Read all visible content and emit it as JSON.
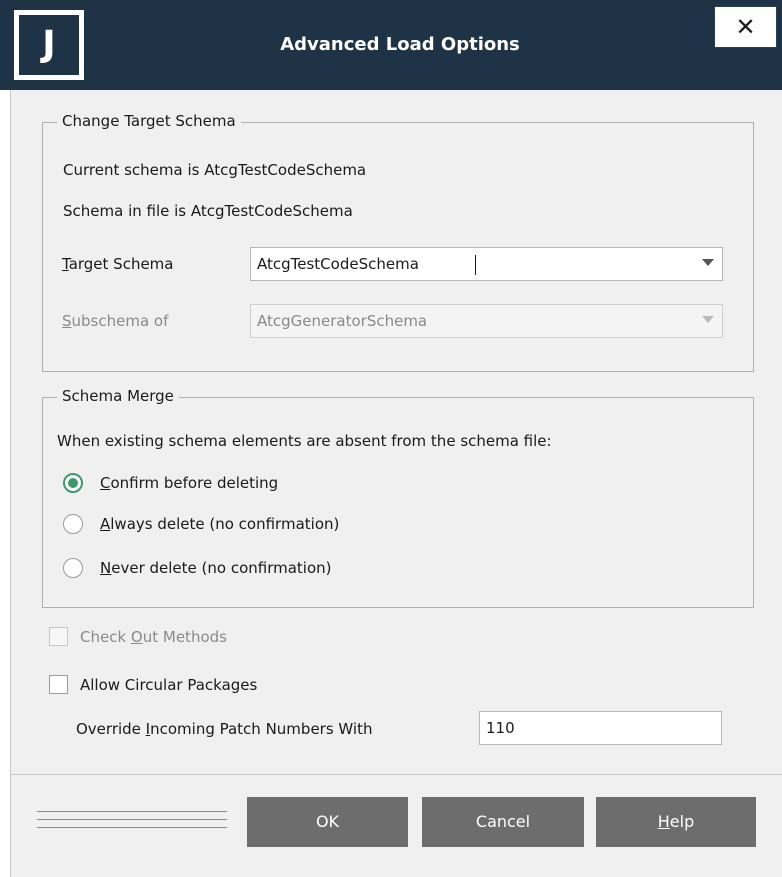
{
  "titlebar": {
    "logo_letter": "J",
    "title": "Advanced Load Options",
    "close_glyph": "✕"
  },
  "change_target": {
    "legend": "Change Target Schema",
    "current_schema_text": "Current schema is AtcgTestCodeSchema",
    "file_schema_text": "Schema in file is AtcgTestCodeSchema",
    "target_schema_label_mnemonic": "T",
    "target_schema_label_rest": "arget Schema",
    "target_schema_value": "AtcgTestCodeSchema",
    "subschema_label_mnemonic": "S",
    "subschema_label_rest": "ubschema of",
    "subschema_value": "AtcgGeneratorSchema"
  },
  "schema_merge": {
    "legend": "Schema Merge",
    "prompt": "When existing schema elements are absent from the schema file:",
    "options": [
      {
        "mnemonic": "C",
        "rest": "onfirm before deleting",
        "selected": true
      },
      {
        "mnemonic": "A",
        "rest": "lways delete (no confirmation)",
        "selected": false
      },
      {
        "mnemonic": "N",
        "rest": "ever delete (no confirmation)",
        "selected": false
      }
    ]
  },
  "check_out_methods": {
    "label_pre": "Check ",
    "label_mnemonic": "O",
    "label_post": "ut Methods",
    "checked": false,
    "enabled": false
  },
  "allow_circular": {
    "label": "Allow Circular Packages",
    "checked": false
  },
  "override_patch": {
    "label_pre": "Override ",
    "label_mnemonic": "I",
    "label_post": "ncoming Patch Numbers With",
    "value": "110"
  },
  "buttons": {
    "ok": "OK",
    "cancel": "Cancel",
    "help_mnemonic": "H",
    "help_rest": "elp"
  },
  "colors": {
    "titlebar": "#1f3346",
    "dialog_bg": "#f0f0f0",
    "button_bg": "#6d6d6d",
    "radio_accent": "#3c9a6a"
  }
}
